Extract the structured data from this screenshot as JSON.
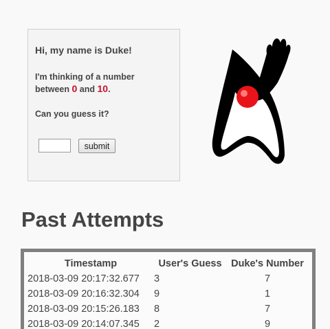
{
  "greeting": {
    "title": "Hi, my name is Duke!",
    "line1": "I'm thinking of a number",
    "between": "between",
    "min": "0",
    "and": "and",
    "max": "10",
    "period": ".",
    "question": "Can you guess it?",
    "input_value": "",
    "submit_label": "submit"
  },
  "mascot": {
    "icon": "duke-mascot-icon"
  },
  "past": {
    "title": "Past Attempts",
    "headers": [
      "Timestamp",
      "User's Guess",
      "Duke's Number"
    ],
    "rows": [
      [
        "2018-03-09 20:17:32.677",
        "3",
        "7"
      ],
      [
        "2018-03-09 20:16:32.304",
        "9",
        "1"
      ],
      [
        "2018-03-09 20:15:26.183",
        "8",
        "7"
      ],
      [
        "2018-03-09 20:14:07.345",
        "2",
        "9"
      ]
    ]
  },
  "colors": {
    "accent_red": "#c8102e",
    "table_border": "#808080"
  }
}
